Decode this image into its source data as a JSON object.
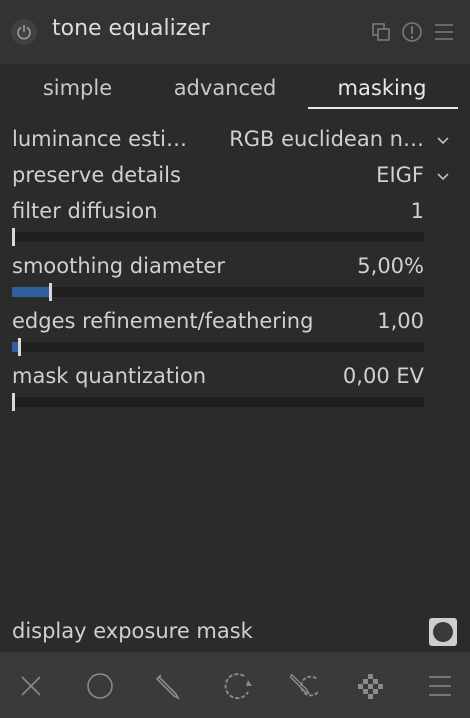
{
  "header": {
    "title": "tone equalizer",
    "icons": [
      "power-icon",
      "multi-instance-icon",
      "reset-icon",
      "presets-icon"
    ]
  },
  "tabs": [
    {
      "label": "simple",
      "active": false
    },
    {
      "label": "advanced",
      "active": false
    },
    {
      "label": "masking",
      "active": true
    }
  ],
  "settings": {
    "luminance_estimator": {
      "label": "luminance esti…",
      "value": "RGB euclidean n…"
    },
    "preserve_details": {
      "label": "preserve details",
      "value": "EIGF"
    },
    "filter_diffusion": {
      "label": "filter diffusion",
      "value": "1",
      "level": 0.0
    },
    "smoothing_diameter": {
      "label": "smoothing diameter",
      "value": "5,00%",
      "level": 0.09
    },
    "edges_refinement": {
      "label": "edges refinement/feathering",
      "value": "1,00",
      "level": 0.015
    },
    "mask_quantization": {
      "label": "mask quantization",
      "value": "0,00 EV",
      "level": 0.0
    }
  },
  "display_mask": {
    "label": "display exposure mask",
    "enabled": false
  },
  "toolbar": [
    "close-icon",
    "circle-icon",
    "path-icon",
    "drawn-parametric-icon",
    "drawn-and-parametric-icon",
    "raster-icon",
    "menu-icon"
  ],
  "colors": {
    "accent": "#2f5f9f",
    "background": "#2b2b2b",
    "header": "#333333"
  }
}
